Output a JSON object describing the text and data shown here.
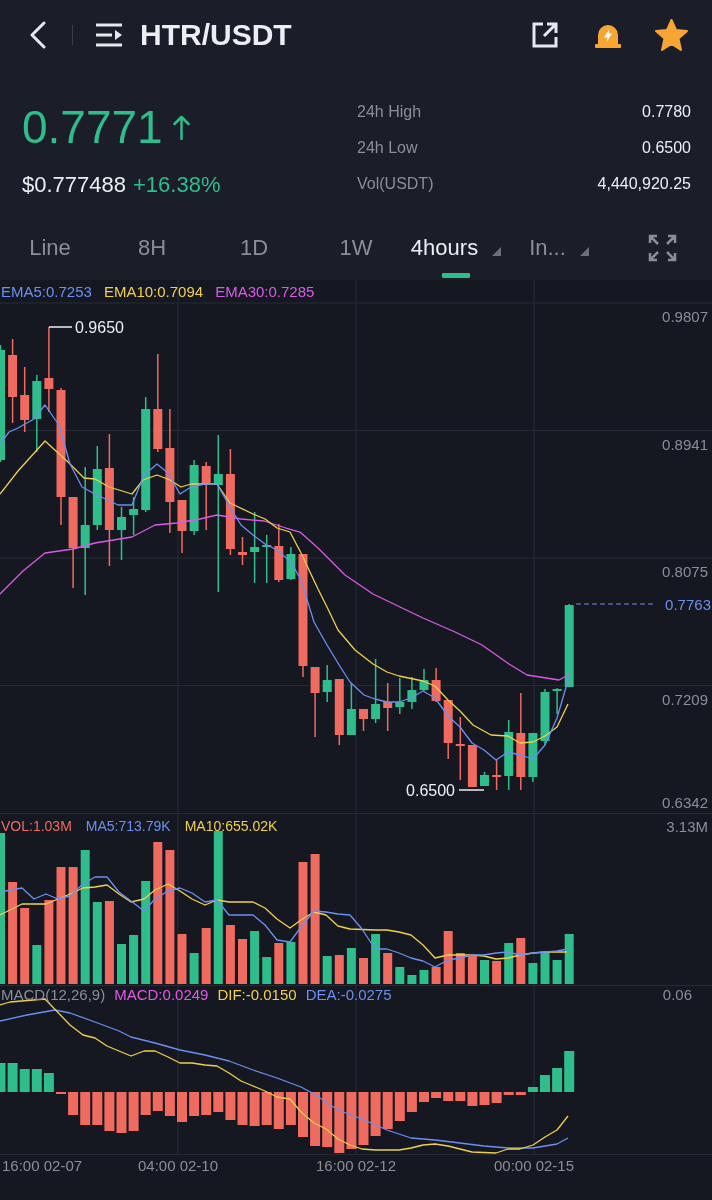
{
  "header": {
    "title": "HTR/USDT",
    "favorite": true
  },
  "ticker": {
    "price": "0.7771",
    "rising": true,
    "usd_price": "$0.777488",
    "change": "+16.38%",
    "stats": [
      {
        "label": "24h High",
        "value": "0.7780"
      },
      {
        "label": "24h Low",
        "value": "0.6500"
      },
      {
        "label": "Vol(USDT)",
        "value": "4,440,920.25"
      }
    ]
  },
  "intervals": [
    {
      "label": "Line",
      "selected": false,
      "dropdown": false
    },
    {
      "label": "8H",
      "selected": false,
      "dropdown": false
    },
    {
      "label": "1D",
      "selected": false,
      "dropdown": false
    },
    {
      "label": "1W",
      "selected": false,
      "dropdown": false
    },
    {
      "label": "4hours",
      "selected": true,
      "dropdown": true
    },
    {
      "label": "In...",
      "selected": false,
      "dropdown": true
    }
  ],
  "price_chart": {
    "legend": [
      {
        "label": "EMA5:0.7253",
        "color": "#6c8ff0"
      },
      {
        "label": "EMA10:0.7094",
        "color": "#f0d04c"
      },
      {
        "label": "EMA30:0.7285",
        "color": "#d95ae6"
      }
    ],
    "y_labels": [
      "0.9807",
      "0.8941",
      "0.8075",
      "0.7209",
      "0.6342"
    ],
    "last_price": "0.7763",
    "high_marker": "0.9650",
    "low_marker": "0.6500"
  },
  "volume_chart": {
    "legend": [
      {
        "label": "VOL:1.03M",
        "color": "#ee6b62"
      },
      {
        "label": "MA5:713.79K",
        "color": "#6c8ff0"
      },
      {
        "label": "MA10:655.02K",
        "color": "#f0d04c"
      }
    ],
    "max_label": "3.13M"
  },
  "macd_chart": {
    "title": "MACD(12,26,9)",
    "legend": [
      {
        "label": "MACD:0.0249",
        "color": "#e457ea"
      },
      {
        "label": "DIF:-0.0150",
        "color": "#f0d04c"
      },
      {
        "label": "DEA:-0.0275",
        "color": "#6c8ff0"
      }
    ],
    "max_label": "0.06"
  },
  "time_labels": [
    "16:00 02-07",
    "04:00 02-10",
    "16:00 02-12",
    "00:00 02-15"
  ]
}
